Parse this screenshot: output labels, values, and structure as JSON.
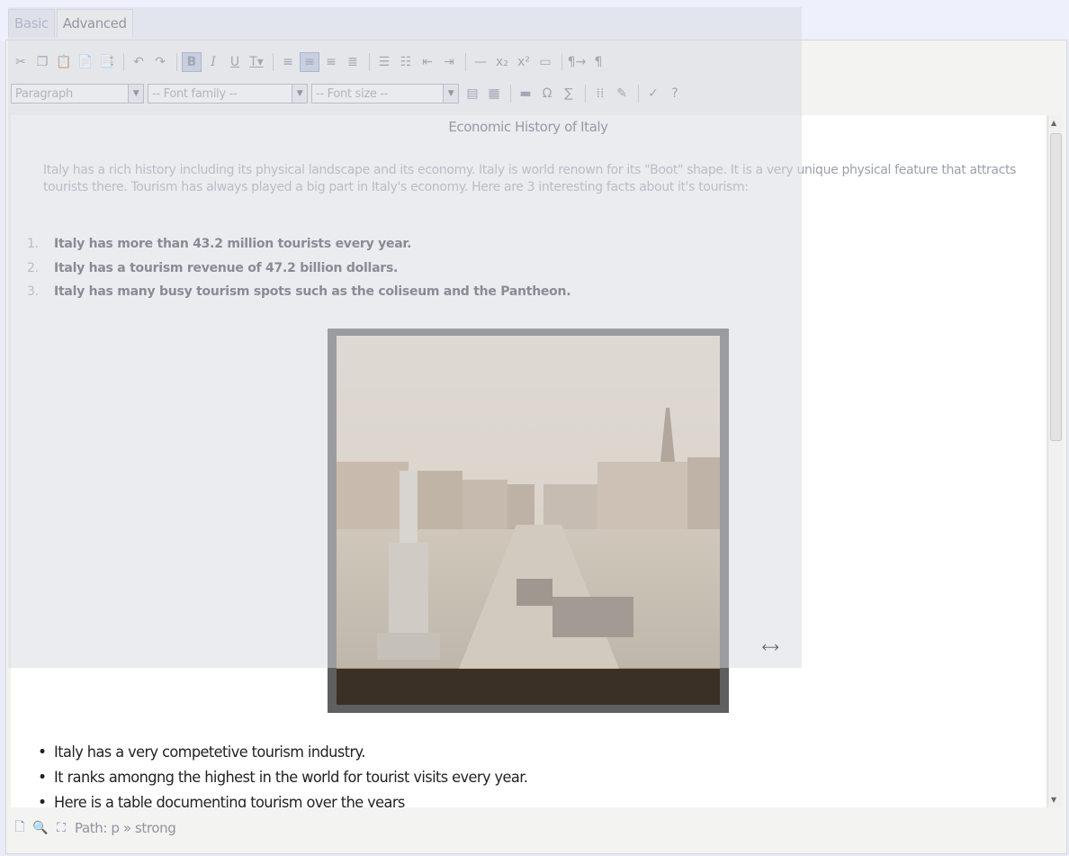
{
  "tabs": [
    "Basic",
    "Advanced"
  ],
  "toolbar": {
    "paragraph": "Paragraph",
    "font_family": "-- Font family --",
    "font_size": "-- Font size --"
  },
  "document": {
    "title": "Economic History of Italy",
    "intro": "Italy has a rich history including its physical landscape and its economy. Italy is world renown for its \"Boot\" shape. It is a very unique physical feature that attracts tourists there. Tourism has always played a big part in Italy's economy. Here are 3 interesting facts about it's tourism:",
    "facts": [
      {
        "num": "1.",
        "text": "Italy has more than 43.2 million tourists every year."
      },
      {
        "num": "2.",
        "text": "Italy has a  tourism revenue of 47.2 billion dollars."
      },
      {
        "num": "3.",
        "text": "Italy has many busy tourism spots such as the coliseum and the Pantheon."
      }
    ],
    "bullets": [
      "Italy has a very competetive tourism industry.",
      "It ranks amongng the highest in the world for tourist visits every year.",
      "Here is a table documenting tourism over the years"
    ]
  },
  "statusbar": {
    "path": "Path: p » strong"
  }
}
